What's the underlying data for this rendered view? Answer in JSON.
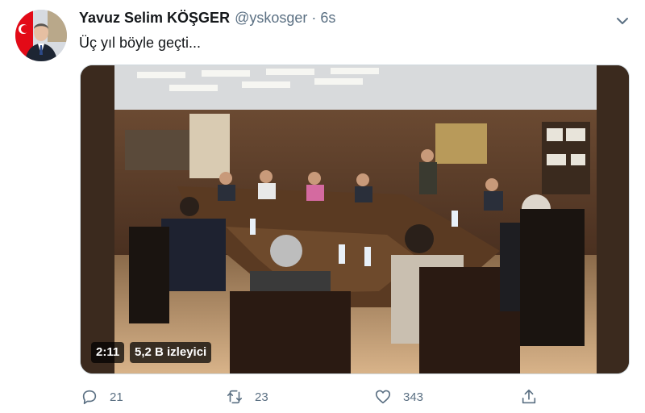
{
  "tweet": {
    "author_name": "Yavuz Selim KÖŞGER",
    "author_handle": "@yskosger",
    "separator": "·",
    "time": "6s",
    "text": "Üç yıl böyle geçti...",
    "video": {
      "duration": "2:11",
      "views": "5,2 B izleyici"
    },
    "actions": {
      "replies": "21",
      "retweets": "23",
      "likes": "343"
    }
  },
  "icons": {
    "more": "chevron-down-icon",
    "reply": "reply-icon",
    "retweet": "retweet-icon",
    "like": "heart-icon",
    "share": "share-icon"
  },
  "colors": {
    "text_primary": "#14171a",
    "text_secondary": "#5b7083",
    "flag_red": "#e30a17"
  }
}
